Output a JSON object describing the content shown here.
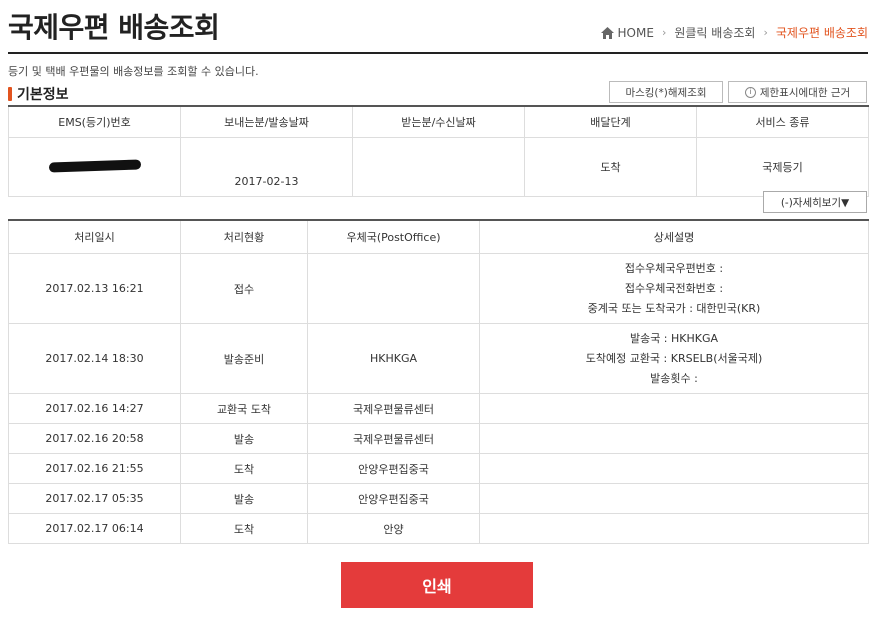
{
  "header": {
    "title": "국제우편 배송조회",
    "breadcrumb": [
      "HOME",
      "원클릭 배송조회",
      "국제우편 배송조회"
    ]
  },
  "description": "등기 및 택배 우편물의 배송정보를 조회할 수 있습니다.",
  "basic_info": {
    "section_title": "기본정보",
    "unmask_button": "마스킹(*)해제조회",
    "basis_button": "제한표시에대한 근거",
    "columns": [
      "EMS(등기)번호",
      "보내는분/발송날짜",
      "받는분/수신날짜",
      "배달단계",
      "서비스 종류"
    ],
    "row": {
      "sender_date": "2017-02-13",
      "recipient_date": "",
      "stage": "도착",
      "service": "국제등기"
    }
  },
  "detail_toggle": "(-)자세히보기▼",
  "tracking": {
    "columns": [
      "처리일시",
      "처리현황",
      "우체국(PostOffice)",
      "상세설명"
    ],
    "rows": [
      {
        "datetime": "2017.02.13 16:21",
        "status": "접수",
        "office": "",
        "details": [
          "접수우체국우편번호 :",
          "접수우체국전화번호 :",
          "중계국 또는 도착국가 : 대한민국(KR)"
        ]
      },
      {
        "datetime": "2017.02.14 18:30",
        "status": "발송준비",
        "office": "HKHKGA",
        "details": [
          "발송국 : HKHKGA",
          "도착예정 교환국 : KRSELB(서울국제)",
          "발송횟수 :"
        ]
      },
      {
        "datetime": "2017.02.16 14:27",
        "status": "교환국 도착",
        "office": "국제우편물류센터",
        "details": []
      },
      {
        "datetime": "2017.02.16 20:58",
        "status": "발송",
        "office": "국제우편물류센터",
        "details": []
      },
      {
        "datetime": "2017.02.16 21:55",
        "status": "도착",
        "office": "안양우편집중국",
        "details": []
      },
      {
        "datetime": "2017.02.17 05:35",
        "status": "발송",
        "office": "안양우편집중국",
        "details": []
      },
      {
        "datetime": "2017.02.17 06:14",
        "status": "도착",
        "office": "안양",
        "details": []
      }
    ]
  },
  "print_button": "인쇄",
  "colors": {
    "accent": "#e2541f",
    "print": "#e43b3b"
  }
}
